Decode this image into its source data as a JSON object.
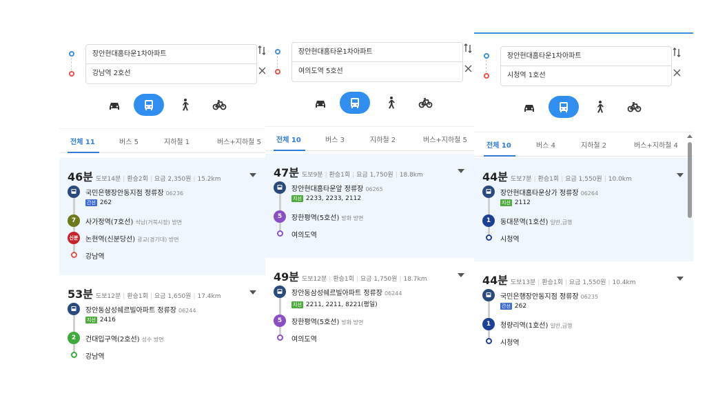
{
  "panels": [
    {
      "start": "장안현대홈타운1차아파트",
      "end": "강남역 2호선",
      "tabs": [
        "전체 11",
        "버스 5",
        "지하철 1",
        "버스+지하철 5"
      ],
      "routes": [
        {
          "time": "46분",
          "walk": "도보14분",
          "transfer": "환승2회",
          "fare": "요금 2,350원",
          "distance": "15.2km",
          "steps": [
            {
              "type": "bus",
              "name": "국민은행장안동지점 정류장",
              "sub": "06236",
              "tag": "간선",
              "tag_kind": "trunk",
              "lines": "262"
            },
            {
              "type": "subway",
              "badge": "7",
              "cls": "l7",
              "name": "사가정역(7호선)",
              "sub": "석남(거북시장) 방면"
            },
            {
              "type": "subway",
              "badge": "신분",
              "cls": "sinbun",
              "name": "논현역(신분당선)",
              "sub": "광교(경기대) 방면"
            },
            {
              "type": "end",
              "name": "강남역",
              "color": "#e8514a"
            }
          ]
        },
        {
          "time": "53분",
          "walk": "도보12분",
          "transfer": "환승1회",
          "fare": "요금 1,650원",
          "distance": "17.4km",
          "steps": [
            {
              "type": "bus",
              "name": "장안동삼성쉐르빌아파트 정류장",
              "sub": "06244",
              "tag": "지선",
              "tag_kind": "branch",
              "lines": "2416"
            },
            {
              "type": "subway",
              "badge": "2",
              "cls": "l2",
              "name": "건대입구역(2호선)",
              "sub": "성수 방면"
            },
            {
              "type": "end",
              "name": "강남역",
              "color": "#3caa3c"
            }
          ]
        }
      ]
    },
    {
      "start": "장안현대홈타운1차아파트",
      "end": "여의도역 5호선",
      "tabs": [
        "전체 10",
        "버스 3",
        "지하철 2",
        "버스+지하철 5"
      ],
      "routes": [
        {
          "time": "47분",
          "walk": "도보9분",
          "transfer": "환승1회",
          "fare": "요금 1,750원",
          "distance": "18.8km",
          "steps": [
            {
              "type": "bus",
              "name": "장안현대홈타운앞 정류장",
              "sub": "06265",
              "tag": "지선",
              "tag_kind": "branch",
              "lines": "2233, 2233, 2112"
            },
            {
              "type": "subway",
              "badge": "5",
              "cls": "l5",
              "name": "장한평역(5호선)",
              "sub": "방화 방면"
            },
            {
              "type": "end",
              "name": "여의도역",
              "color": "#8a4fc4"
            }
          ]
        },
        {
          "time": "49분",
          "walk": "도보12분",
          "transfer": "환승1회",
          "fare": "요금 1,750원",
          "distance": "18.7km",
          "steps": [
            {
              "type": "bus",
              "name": "장안동삼성쉐르빌아파트 정류장",
              "sub": "06244",
              "tag": "지선",
              "tag_kind": "branch",
              "lines": "2211, 2211, 8221(평일)"
            },
            {
              "type": "subway",
              "badge": "5",
              "cls": "l5",
              "name": "장한평역(5호선)",
              "sub": "방화 방면"
            },
            {
              "type": "end",
              "name": "여의도역",
              "color": "#8a4fc4"
            }
          ]
        }
      ]
    },
    {
      "start": "장안현대홈타운1차아파트",
      "end": "시청역 1호선",
      "tabs": [
        "전체 10",
        "버스 4",
        "지하철 2",
        "버스+지하철 4"
      ],
      "routes": [
        {
          "time": "44분",
          "walk": "도보7분",
          "transfer": "환승1회",
          "fare": "요금 1,550원",
          "distance": "10.0km",
          "steps": [
            {
              "type": "bus",
              "name": "장안현대홈타운상가 정류장",
              "sub": "06264",
              "tag": "지선",
              "tag_kind": "branch",
              "lines": "2112"
            },
            {
              "type": "subway",
              "badge": "1",
              "cls": "l1",
              "name": "동대문역(1호선)",
              "sub": "일반,급행"
            },
            {
              "type": "end",
              "name": "시청역",
              "color": "#1e3f96"
            }
          ]
        },
        {
          "time": "44분",
          "walk": "도보13분",
          "transfer": "환승1회",
          "fare": "요금 1,550원",
          "distance": "10.4km",
          "steps": [
            {
              "type": "bus",
              "name": "국민은행장안동지점 정류장",
              "sub": "06235",
              "tag": "간선",
              "tag_kind": "trunk",
              "lines": "262"
            },
            {
              "type": "subway",
              "badge": "1",
              "cls": "l1",
              "name": "청량리역(1호선)",
              "sub": "일반,급행"
            },
            {
              "type": "end",
              "name": "시청역",
              "color": "#1e3f96"
            }
          ]
        }
      ]
    }
  ],
  "colors": {
    "accent": "#2f8ef0",
    "tab_active": "#2f7bd8",
    "highlight_bg": "#f0f6fd"
  },
  "icons": {
    "modes": [
      "car-icon",
      "bus-icon",
      "walk-icon",
      "bike-icon"
    ],
    "swap": "swap-icon",
    "clear": "close-icon"
  }
}
